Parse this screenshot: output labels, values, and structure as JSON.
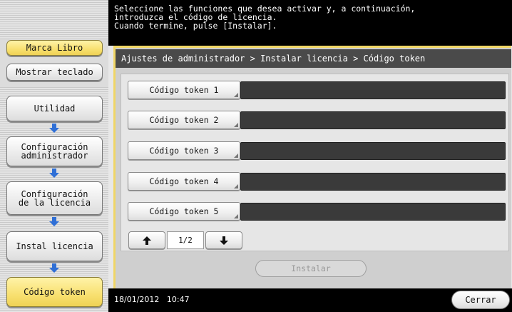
{
  "sidebar": {
    "marca_libro": "Marca Libro",
    "mostrar_teclado": "Mostrar teclado",
    "steps": [
      {
        "label": "Utilidad"
      },
      {
        "label": "Configuración\nadministrador"
      },
      {
        "label": "Configuración\nde la licencia"
      },
      {
        "label": "Instal licencia"
      },
      {
        "label": "Código token"
      }
    ]
  },
  "message": "Seleccione las funciones que desea activar y, a continuación,\nintroduzca el código de licencia.\nCuando termine, pulse [Instalar].",
  "breadcrumb": "Ajustes de administrador > Instalar licencia > Código token",
  "tokens": [
    {
      "label": "Código token 1",
      "value": ""
    },
    {
      "label": "Código token 2",
      "value": ""
    },
    {
      "label": "Código token 3",
      "value": ""
    },
    {
      "label": "Código token 4",
      "value": ""
    },
    {
      "label": "Código token 5",
      "value": ""
    }
  ],
  "pager": {
    "page": "1/2",
    "up_icon": "arrow-up-icon",
    "down_icon": "arrow-down-icon"
  },
  "install_label": "Instalar",
  "status": {
    "datetime": "18/01/2012   10:47"
  },
  "close_label": "Cerrar",
  "colors": {
    "accent": "#f0d666",
    "active_button": "#f8e070",
    "step_arrow": "#2f6fd6"
  }
}
